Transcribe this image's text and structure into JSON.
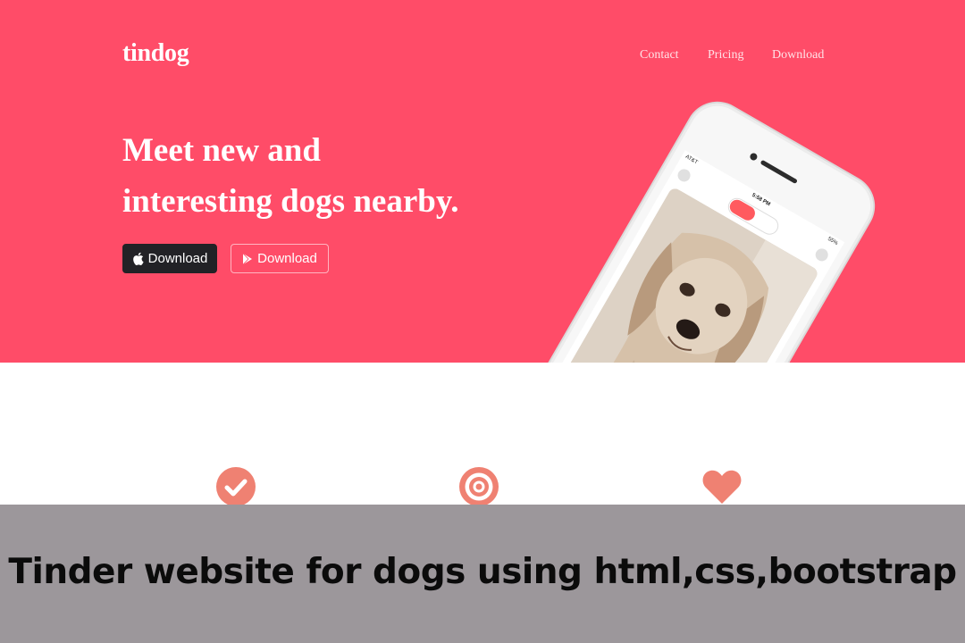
{
  "hero": {
    "brand": "tindog",
    "nav": {
      "contact": "Contact",
      "pricing": "Pricing",
      "download": "Download"
    },
    "headline": {
      "line1": "Meet new and",
      "line2": "interesting dogs nearby."
    },
    "buttons": {
      "apple_label": "Download",
      "play_label": "Download"
    },
    "phone": {
      "carrier": "AT&T",
      "time": "5:58 PM",
      "battery": "55%"
    }
  },
  "features": {
    "icons": [
      "check-circle-icon",
      "bullseye-icon",
      "heart-icon"
    ]
  },
  "caption": {
    "text": "Tinder website for dogs using html,css,bootstrap"
  },
  "colors": {
    "hero_bg": "#ff4c68",
    "icon_accent": "#ef8172",
    "caption_bg": "#9c979b"
  }
}
